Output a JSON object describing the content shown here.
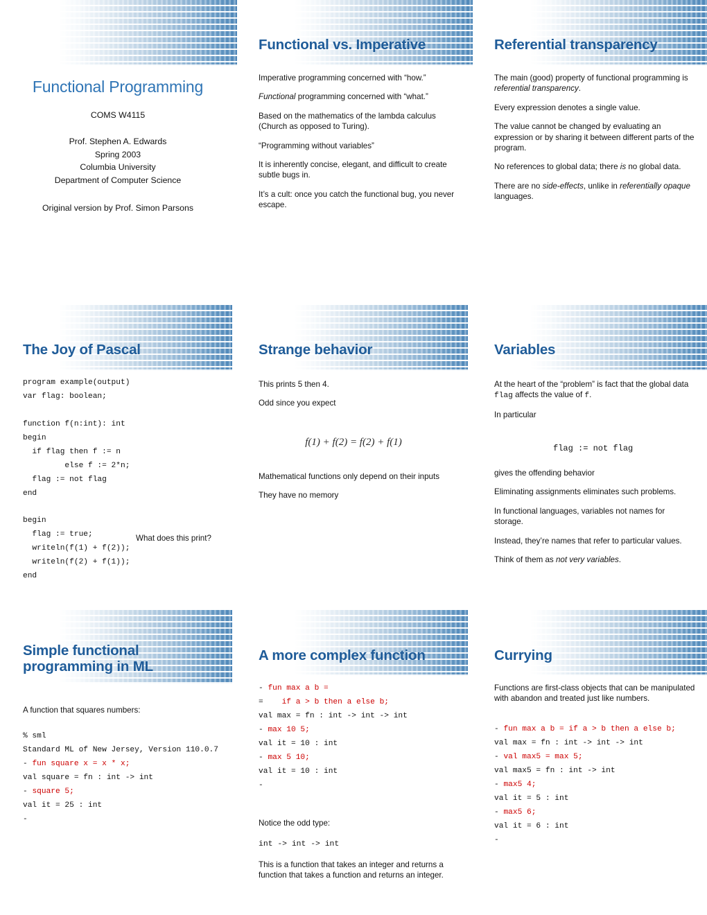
{
  "document": {
    "kind": "lecture-slide-handout",
    "columns": 3,
    "rows": 3,
    "accent_title_color": "#1F5C99",
    "cover_title_color": "#2E74B5",
    "code_highlight_color": "#CC0000"
  },
  "slides": [
    {
      "id": "cover",
      "title": "Functional Programming",
      "course": "COMS W4115",
      "author": "Prof. Stephen A. Edwards",
      "term": "Spring 2003",
      "school": "Columbia University",
      "department": "Department of Computer Science",
      "credit": "Original version by Prof. Simon Parsons"
    },
    {
      "id": "functional-vs-imperative",
      "title": "Functional vs. Imperative",
      "paragraphs": [
        "Imperative programming concerned with “how.”",
        "Functional programming concerned with “what.”",
        "Based on the mathematics of the lambda calculus (Church as opposed to Turing).",
        "“Programming without variables”",
        "It is inherently concise, elegant, and difficult to create subtle bugs in.",
        "It’s a cult: once you catch the functional bug, you never escape."
      ],
      "p1": "Imperative programming concerned with “how.”",
      "p2_em": "Functional",
      "p2_rest": " programming concerned with “what.”",
      "p3": "Based on the mathematics of the lambda calculus (Church as opposed to Turing).",
      "p4": "“Programming without variables”",
      "p5": "It is inherently concise, elegant, and difficult to create subtle bugs in.",
      "p6": "It’s a cult: once you catch the functional bug, you never escape."
    },
    {
      "id": "referential-transparency",
      "title": "Referential transparency",
      "p1_lead": "The main (good) property of functional programming is ",
      "p1_em": "referential transparency",
      "p1_tail": ".",
      "p2": "Every expression denotes a single value.",
      "p3": "The value cannot be changed by evaluating an expression or by sharing it between different parts of the program.",
      "p4_lead": "No references to global data; there ",
      "p4_em": "is",
      "p4_tail": " no global data.",
      "p5_lead": "There are no ",
      "p5_em1": "side-effects",
      "p5_mid": ", unlike in ",
      "p5_em2": "referentially opaque",
      "p5_tail": " languages."
    },
    {
      "id": "joy-of-pascal",
      "title": "The Joy of Pascal",
      "code": "program example(output)\nvar flag: boolean;\n\nfunction f(n:int): int\nbegin\n  if flag then f := n\n         else f := 2*n;\n  flag := not flag\nend\n\nbegin\n  flag := true;\n  writeln(f(1) + f(2));\n  writeln(f(2) + f(1));\nend",
      "callout": "What does this print?"
    },
    {
      "id": "strange-behavior",
      "title": "Strange behavior",
      "p1": "This prints 5 then 4.",
      "p2": "Odd since you expect",
      "formula": "f(1) + f(2) = f(2) + f(1)",
      "p3": "Mathematical functions only depend on their inputs",
      "p4": "They have no memory"
    },
    {
      "id": "variables",
      "title": "Variables",
      "p1_lead": "At the heart of the “problem” is fact that the global data ",
      "p1_code1": "flag",
      "p1_mid": " affects the value of ",
      "p1_code2": "f",
      "p1_tail": ".",
      "p2": "In particular",
      "code_line": "flag := not flag",
      "p3": "gives the offending behavior",
      "p4": "Eliminating assignments eliminates such problems.",
      "p5": "In functional languages, variables not names for storage.",
      "p6": "Instead, they’re names that refer to particular values.",
      "p7_lead": "Think of them as ",
      "p7_em": "not very variables",
      "p7_tail": "."
    },
    {
      "id": "simple-fp-in-ml",
      "title": "Simple functional programming in ML",
      "intro": "A function that squares numbers:",
      "code_lines": [
        {
          "black": "% sml",
          "red": ""
        },
        {
          "black": "Standard ML of New Jersey, Version 110.0.7",
          "red": ""
        },
        {
          "black": "- ",
          "red": "fun square x = x * x;"
        },
        {
          "black": "val square = fn : int -> int",
          "red": ""
        },
        {
          "black": "- ",
          "red": "square 5;"
        },
        {
          "black": "val it = 25 : int",
          "red": ""
        },
        {
          "black": "-",
          "red": ""
        }
      ]
    },
    {
      "id": "more-complex-function",
      "title": "A more complex function",
      "code_lines": [
        {
          "black": "- ",
          "red": "fun max a b ="
        },
        {
          "black": "= ",
          "red": "   if a > b then a else b;"
        },
        {
          "black": "val max = fn : int -> int -> int",
          "red": ""
        },
        {
          "black": "- ",
          "red": "max 10 5;"
        },
        {
          "black": "val it = 10 : int",
          "red": ""
        },
        {
          "black": "- ",
          "red": "max 5 10;"
        },
        {
          "black": "val it = 10 : int",
          "red": ""
        },
        {
          "black": "-",
          "red": ""
        }
      ],
      "note1": "Notice the odd type:",
      "type_line": "int -> int -> int",
      "note2": "This is a function that takes an integer and returns a function that takes a function and returns an integer."
    },
    {
      "id": "currying",
      "title": "Currying",
      "intro": "Functions are first-class objects that can be manipulated with abandon and treated just like numbers.",
      "code_lines": [
        {
          "black": "- ",
          "red": "fun max a b = if a > b then a else b;"
        },
        {
          "black": "val max = fn : int -> int -> int",
          "red": ""
        },
        {
          "black": "- ",
          "red": "val max5 = max 5;"
        },
        {
          "black": "val max5 = fn : int -> int",
          "red": ""
        },
        {
          "black": "- ",
          "red": "max5 4;"
        },
        {
          "black": "val it = 5 : int",
          "red": ""
        },
        {
          "black": "- ",
          "red": "max5 6;"
        },
        {
          "black": "val it = 6 : int",
          "red": ""
        },
        {
          "black": "-",
          "red": ""
        }
      ]
    }
  ]
}
